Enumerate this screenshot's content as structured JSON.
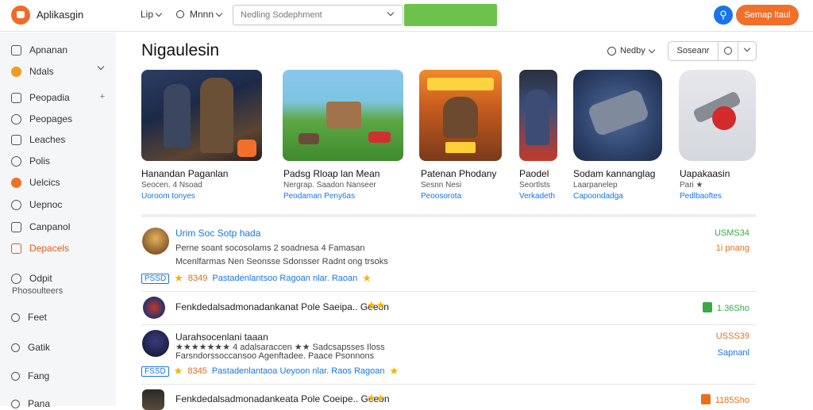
{
  "app": {
    "title": "Aplikasgin"
  },
  "topbar": {
    "nav_1": "Lip",
    "nav_2": "Mnnn",
    "search_placeholder": "Nedling Sodephment",
    "action_button": "Semap ltaul",
    "account_icon": "person-icon"
  },
  "sidebar": {
    "items": [
      {
        "label": "Apnanan",
        "icon": "bag-icon"
      },
      {
        "label": "Ndals",
        "icon": "circle-icon",
        "has_chevron": true
      },
      {
        "label": "Peopadia",
        "icon": "box-icon",
        "badge": "+"
      },
      {
        "label": "Peopages",
        "icon": "gear-icon"
      },
      {
        "label": "Leaches",
        "icon": "doc-icon"
      },
      {
        "label": "Polis",
        "icon": "chat-icon"
      },
      {
        "label": "Uelcics",
        "icon": "play-icon"
      },
      {
        "label": "Uepnoc",
        "icon": "settings-icon"
      },
      {
        "label": "Canpanol",
        "icon": "square-icon"
      },
      {
        "label": "Depacels",
        "icon": "list-icon",
        "active": true
      },
      {
        "label": "Odpit",
        "icon": "pin-icon"
      },
      {
        "label": "Feet",
        "icon": "search-icon"
      },
      {
        "label": "Gatik",
        "icon": "search-icon"
      },
      {
        "label": "Fang",
        "icon": "search-icon"
      },
      {
        "label": "Pana",
        "icon": "search-icon"
      }
    ],
    "sub_label": "Phosoulteers"
  },
  "main": {
    "title": "Nigaulesin",
    "sort_label": "Nedby",
    "segment_label": "Soseanr",
    "cards": [
      {
        "title": "Hanandan Paganlan",
        "sub": "Seocen. 4 Nsoad",
        "link": "Uoroom tonyes"
      },
      {
        "title": "Padsg Rloap lan Mean",
        "sub": "Nergrap. Saadon Nanseer",
        "link": "Peodaman Peny6as"
      },
      {
        "title": "Patenan Phodany",
        "sub": "Sesnn Nesi",
        "link": "Peoosorota"
      },
      {
        "title": "Paodel",
        "sub": "Seortlsts",
        "link": "Verkadeth"
      },
      {
        "title": "Sodam kannanglag",
        "sub": "Laarpanelep",
        "link": "Capoondadga"
      },
      {
        "title": "Uapakaasin",
        "sub": "Pari ★",
        "link": "Pedlbaoftes"
      }
    ],
    "rows": [
      {
        "title": "Urim Soc Sotp hada",
        "line1": "Perne soant socosolams 2 soadnesa 4 Famasan",
        "line2": "Mcenlfarmas Nen Seonsse Sdonsser Radnt ong trsoks",
        "meta_tag": "PSSD",
        "meta_rating": "8349",
        "meta_text": "Pastadenlantsoo Ragoan nlar. Raoan",
        "price_1": "USMS34",
        "price_2": "1i pnang",
        "price_1_color": "#3aa845",
        "price_2_color": "#e8701c"
      },
      {
        "title": "Fenkdedalsadmonadankanat Pole Saeipa.. Geeon",
        "price_1": "1.36Sho",
        "price_badge_color": "#3aa845"
      },
      {
        "title": "Uarahsocenlani taaan",
        "line1": "★★★★★★★ 4 adalsaraccen ★★ Sadcsapsses Iloss",
        "line2": "Farsndorssoccansoo Agenftadee. Paace Psonnons",
        "meta_tag": "FSSD",
        "meta_rating": "8345",
        "meta_text": "Pastadenlantaoa Ueyoon nlar. Raos Ragoan",
        "price_1": "USSS39",
        "price_2": "Sapnanl",
        "price_1_color": "#e8701c",
        "price_2_color": "#1a73e8"
      },
      {
        "title": "Fenkdedalsadmonadankeata Pole Coeipe.. Geeon",
        "price_1": "1185Sho",
        "price_badge_color": "#e8701c"
      }
    ]
  },
  "colors": {
    "accent": "#f0702a",
    "primary": "#1a73e8",
    "green": "#6cc24a"
  }
}
